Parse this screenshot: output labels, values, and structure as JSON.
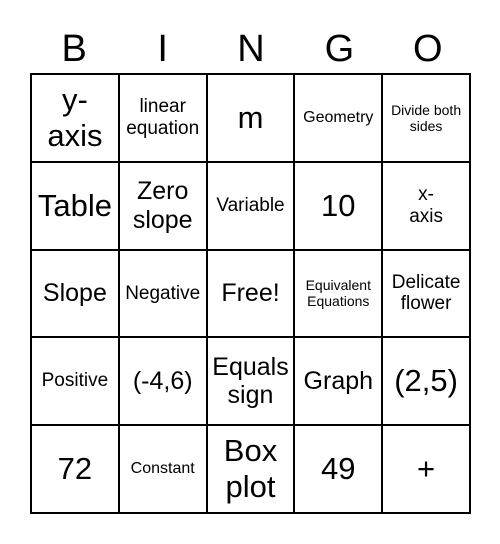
{
  "header": [
    "B",
    "I",
    "N",
    "G",
    "O"
  ],
  "cells": [
    {
      "text": "y-\naxis",
      "size": "xl"
    },
    {
      "text": "linear equation",
      "size": "md"
    },
    {
      "text": "m",
      "size": "xl"
    },
    {
      "text": "Geometry",
      "size": "sm"
    },
    {
      "text": "Divide both sides",
      "size": "xs"
    },
    {
      "text": "Table",
      "size": "xl"
    },
    {
      "text": "Zero slope",
      "size": "lg"
    },
    {
      "text": "Variable",
      "size": "md"
    },
    {
      "text": "10",
      "size": "xl"
    },
    {
      "text": "x-\naxis",
      "size": "md"
    },
    {
      "text": "Slope",
      "size": "lg"
    },
    {
      "text": "Negative",
      "size": "md"
    },
    {
      "text": "Free!",
      "size": "lg"
    },
    {
      "text": "Equivalent Equations",
      "size": "xs"
    },
    {
      "text": "Delicate flower",
      "size": "md"
    },
    {
      "text": "Positive",
      "size": "md"
    },
    {
      "text": "(-4,6)",
      "size": "lg"
    },
    {
      "text": "Equals sign",
      "size": "lg"
    },
    {
      "text": "Graph",
      "size": "lg"
    },
    {
      "text": "(2,5)",
      "size": "xl"
    },
    {
      "text": "72",
      "size": "xl"
    },
    {
      "text": "Constant",
      "size": "sm"
    },
    {
      "text": "Box plot",
      "size": "xl"
    },
    {
      "text": "49",
      "size": "xl"
    },
    {
      "text": "+",
      "size": "xl"
    }
  ]
}
